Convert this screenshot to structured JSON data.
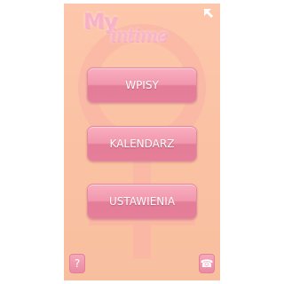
{
  "app": {
    "logo_text_my": "My",
    "logo_text_intime": "intime"
  },
  "menu": {
    "items": [
      {
        "label": "WPISY"
      },
      {
        "label": "KALENDARZ"
      },
      {
        "label": "USTAWIENIA"
      }
    ]
  },
  "footer": {
    "help_glyph": "?",
    "phone_glyph": "☎"
  },
  "colors": {
    "background": "#fbc2a4",
    "button": "#f197ad",
    "logo": "#f7b2c4",
    "venus_symbol": "#f9b5a6"
  },
  "icons": {
    "top_right": "arrow-up-left-icon",
    "background": "venus-symbol-icon",
    "help": "question-mark-icon",
    "phone": "phone-icon"
  }
}
